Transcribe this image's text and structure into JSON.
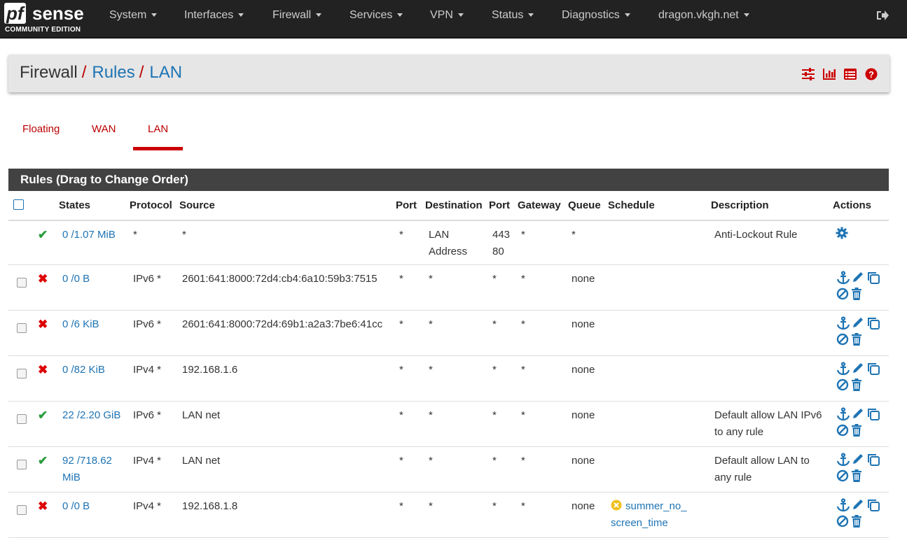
{
  "navbar": {
    "logo_pf": "pf",
    "logo_sense": "sense",
    "logo_edition": "COMMUNITY EDITION",
    "menus": [
      "System",
      "Interfaces",
      "Firewall",
      "Services",
      "VPN",
      "Status",
      "Diagnostics",
      "dragon.vkgh.net"
    ],
    "logout_icon": "sign-out-icon"
  },
  "breadcrumb": {
    "root": "Firewall",
    "sep1": "/",
    "rules": "Rules",
    "sep2": "/",
    "current": "LAN",
    "icons": [
      "sliders-icon",
      "bar-chart-icon",
      "list-table-icon",
      "help-icon"
    ]
  },
  "tabs": [
    "Floating",
    "WAN",
    "LAN"
  ],
  "active_tab": "LAN",
  "panel": {
    "title": "Rules (Drag to Change Order)"
  },
  "table": {
    "headers": {
      "states": "States",
      "protocol": "Protocol",
      "source": "Source",
      "port": "Port",
      "destination": "Destination",
      "dport": "Port",
      "gateway": "Gateway",
      "queue": "Queue",
      "schedule": "Schedule",
      "description": "Description",
      "actions": "Actions"
    },
    "rows": [
      {
        "status": "pass",
        "states1": "0 /1.07 MiB",
        "states2": "",
        "protocol": "*",
        "source": "*",
        "port": "*",
        "dest1": "LAN",
        "dest2": "Address",
        "dport1": "443",
        "dport2": "80",
        "gateway": "*",
        "queue": "*",
        "schedule": "",
        "sched2": "",
        "desc1": "Anti-Lockout Rule",
        "desc2": ""
      },
      {
        "status": "block",
        "states1": "0 /0 B",
        "states2": "",
        "protocol": "IPv6 *",
        "source": "2601:641:8000:72d4:cb4:6a10:59b3:7515",
        "port": "*",
        "dest1": "*",
        "dest2": "",
        "dport1": "*",
        "dport2": "",
        "gateway": "*",
        "queue": "none",
        "schedule": "",
        "sched2": "",
        "desc1": "",
        "desc2": ""
      },
      {
        "status": "block",
        "states1": "0 /6 KiB",
        "states2": "",
        "protocol": "IPv6 *",
        "source": "2601:641:8000:72d4:69b1:a2a3:7be6:41cc",
        "port": "*",
        "dest1": "*",
        "dest2": "",
        "dport1": "*",
        "dport2": "",
        "gateway": "*",
        "queue": "none",
        "schedule": "",
        "sched2": "",
        "desc1": "",
        "desc2": ""
      },
      {
        "status": "block",
        "states1": "0 /82 KiB",
        "states2": "",
        "protocol": "IPv4 *",
        "source": "192.168.1.6",
        "port": "*",
        "dest1": "*",
        "dest2": "",
        "dport1": "*",
        "dport2": "",
        "gateway": "*",
        "queue": "none",
        "schedule": "",
        "sched2": "",
        "desc1": "",
        "desc2": ""
      },
      {
        "status": "pass",
        "states1": "22 /2.20 GiB",
        "states2": "",
        "protocol": "IPv6 *",
        "source": "LAN net",
        "port": "*",
        "dest1": "*",
        "dest2": "",
        "dport1": "*",
        "dport2": "",
        "gateway": "*",
        "queue": "none",
        "schedule": "",
        "sched2": "",
        "desc1": "Default allow LAN IPv6",
        "desc2": "to any rule"
      },
      {
        "status": "pass",
        "states1": "92 /718.62",
        "states2": "MiB",
        "protocol": "IPv4 *",
        "source": "LAN net",
        "port": "*",
        "dest1": "*",
        "dest2": "",
        "dport1": "*",
        "dport2": "",
        "gateway": "*",
        "queue": "none",
        "schedule": "",
        "sched2": "",
        "desc1": "Default allow LAN to",
        "desc2": "any rule"
      },
      {
        "status": "block",
        "states1": "0 /0 B",
        "states2": "",
        "protocol": "IPv4 *",
        "source": "192.168.1.8",
        "port": "*",
        "dest1": "*",
        "dest2": "",
        "dport1": "*",
        "dport2": "",
        "gateway": "*",
        "queue": "none",
        "schedule": "summer_no_",
        "sched2": "screen_time",
        "desc1": "",
        "desc2": ""
      }
    ]
  },
  "colors": {
    "navbar": "#222222",
    "link": "#1e74b4",
    "accent_red": "#cc0000",
    "pass_green": "#2a9d3c",
    "block_red": "#dd0000",
    "schedule_icon": "#f0c020"
  }
}
